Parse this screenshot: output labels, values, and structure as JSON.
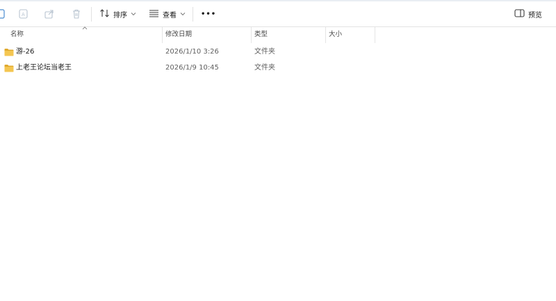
{
  "toolbar": {
    "sort_label": "排序",
    "view_label": "查看",
    "more_label": "•••",
    "preview_label": "预览"
  },
  "columns": {
    "name": "名称",
    "modified": "修改日期",
    "type": "类型",
    "size": "大小"
  },
  "rows": [
    {
      "name": "游-26",
      "modified": "2026/1/10 3:26",
      "type": "文件夹",
      "size": ""
    },
    {
      "name": "上老王论坛当老王",
      "modified": "2026/1/9 10:45",
      "type": "文件夹",
      "size": ""
    }
  ],
  "colors": {
    "folder": "#f4c651",
    "folder_dark": "#e0a92c",
    "accent": "#0067c0",
    "icon_disabled": "#b8c4d0"
  }
}
